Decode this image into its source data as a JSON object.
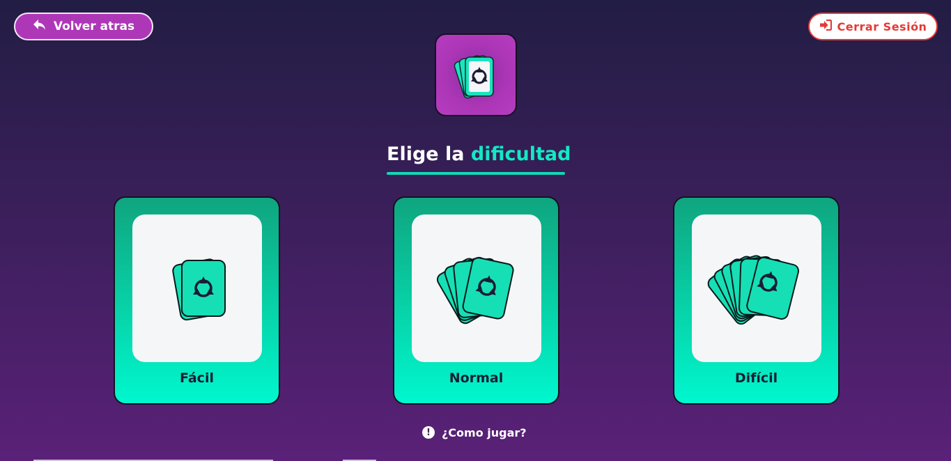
{
  "header": {
    "back_label": "Volver atras",
    "logout_label": "Cerrar Sesión"
  },
  "title": {
    "part1": "Elige la",
    "part2": "dificultad"
  },
  "difficulties": [
    {
      "label": "Fácil",
      "cards": 2
    },
    {
      "label": "Normal",
      "cards": 4
    },
    {
      "label": "Difícil",
      "cards": 6
    }
  ],
  "help": {
    "label": "¿Como jugar?",
    "icon": "exclamation-circle-icon"
  },
  "colors": {
    "accent": "#13e9c5",
    "purple_button": "#ae37b8",
    "logout_red": "#e53935",
    "card_text": "#1b1d33"
  }
}
